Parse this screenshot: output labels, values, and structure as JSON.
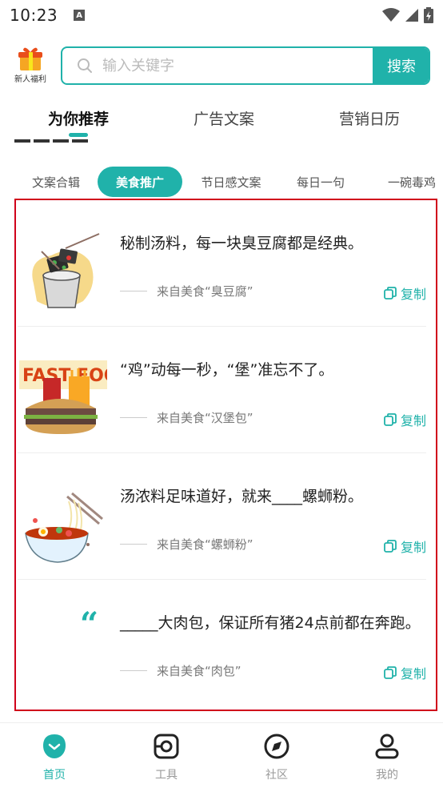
{
  "status_bar": {
    "time": "10:23",
    "notif_letter": "A"
  },
  "header": {
    "gift_label": "新人福利",
    "search_placeholder": "输入关键字",
    "search_button": "搜索"
  },
  "main_tabs": [
    {
      "label": "为你推荐",
      "active": true
    },
    {
      "label": "广告文案",
      "active": false
    },
    {
      "label": "营销日历",
      "active": false
    }
  ],
  "sub_tabs": [
    {
      "label": "文案合辑",
      "active": false
    },
    {
      "label": "美食推广",
      "active": true
    },
    {
      "label": "节日感文案",
      "active": false
    },
    {
      "label": "每日一句",
      "active": false
    },
    {
      "label": "一碗毒鸡",
      "active": false
    }
  ],
  "cards": [
    {
      "text": "秘制汤料，每一块臭豆腐都是经典。",
      "source": "来自美食“臭豆腐”",
      "copy": "复制",
      "image": "stinky-tofu"
    },
    {
      "text": "“鸡”动每一秒，“堡”准忘不了。",
      "source": "来自美食“汉堡包”",
      "copy": "复制",
      "image": "burger"
    },
    {
      "text": "汤浓料足味道好，就来____螺蛳粉。",
      "source": "来自美食“螺蛳粉”",
      "copy": "复制",
      "image": "noodles"
    },
    {
      "text": "_____大肉包，保证所有猪24点前都在奔跑。",
      "source": "来自美食“肉包”",
      "copy": "复制",
      "image": "quote",
      "quote_mark": "“"
    }
  ],
  "bottom_nav": [
    {
      "label": "首页",
      "active": true,
      "icon": "home-icon"
    },
    {
      "label": "工具",
      "active": false,
      "icon": "tools-icon"
    },
    {
      "label": "社区",
      "active": false,
      "icon": "compass-icon"
    },
    {
      "label": "我的",
      "active": false,
      "icon": "profile-icon"
    }
  ],
  "colors": {
    "accent": "#20b2aa",
    "highlight_border": "#d0021b"
  }
}
